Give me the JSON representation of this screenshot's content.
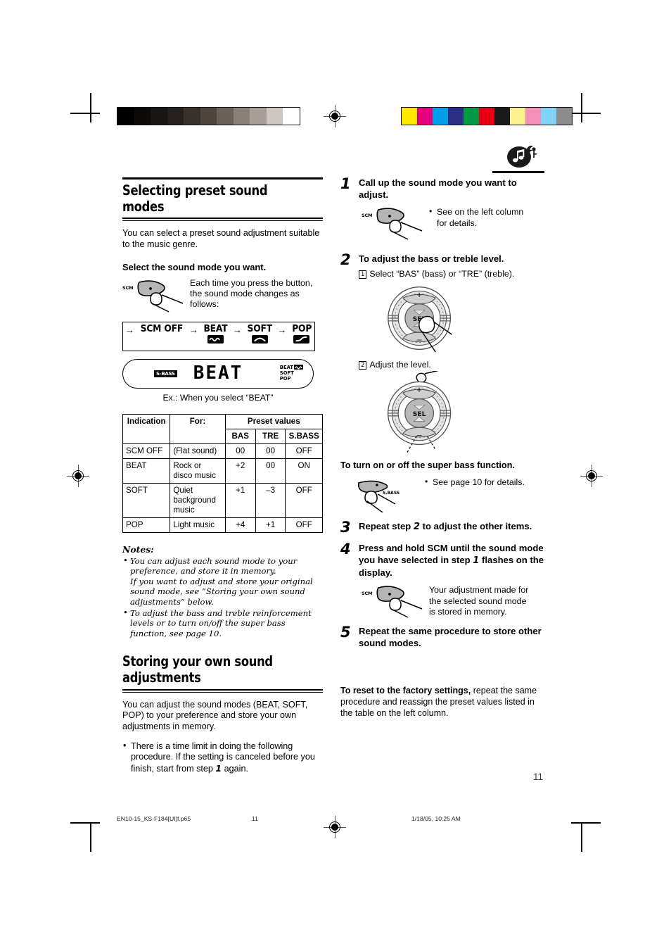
{
  "meta": {
    "page_number": "11"
  },
  "header_icon": "music-note-bag-icon",
  "left": {
    "section1": {
      "heading": "Selecting preset sound modes",
      "intro": "You can select a preset sound adjustment suitable to the music genre.",
      "subhead": "Select the sound mode you want.",
      "button_label": "SCM",
      "button_caption": "Each time you press the button, the sound mode changes as follows:",
      "flow": [
        {
          "name": "SCM OFF",
          "icon": ""
        },
        {
          "name": "BEAT",
          "icon": "wave-beat-icon"
        },
        {
          "name": "SOFT",
          "icon": "wave-soft-icon"
        },
        {
          "name": "POP",
          "icon": "wave-pop-icon"
        }
      ],
      "arrow": "→",
      "display": {
        "sbass_label": "S-BASS",
        "main_text": "BEAT",
        "indicators": [
          "BEAT",
          "SOFT",
          "POP"
        ],
        "beat_icon": "wave-beat-icon"
      },
      "example_caption": "Ex.: When you select “BEAT”"
    },
    "table": {
      "headers": {
        "indication": "Indication",
        "for": "For:",
        "preset_values": "Preset values",
        "bas": "BAS",
        "tre": "TRE",
        "sbass": "S.BASS"
      },
      "rows": [
        {
          "indication": "SCM OFF",
          "for": "(Flat sound)",
          "bas": "00",
          "tre": "00",
          "sbass": "OFF"
        },
        {
          "indication": "BEAT",
          "for": "Rock or disco music",
          "bas": "+2",
          "tre": "00",
          "sbass": "ON"
        },
        {
          "indication": "SOFT",
          "for": "Quiet background music",
          "bas": "+1",
          "tre": "–3",
          "sbass": "OFF"
        },
        {
          "indication": "POP",
          "for": "Light music",
          "bas": "+4",
          "tre": "+1",
          "sbass": "OFF"
        }
      ]
    },
    "notes": {
      "heading": "Notes:",
      "items": [
        {
          "line1": "You can adjust each sound mode to your preference, and store it in memory.",
          "line2": "If you want to adjust and store your original sound mode, see “Storing your own sound adjustments” below."
        },
        {
          "line1": "To adjust the bass and treble reinforcement levels or to turn on/off the super bass function, see page 10.",
          "line2": ""
        }
      ]
    },
    "section2": {
      "heading_line1": "Storing your own sound",
      "heading_line2": "adjustments",
      "intro": "You can adjust the sound modes (BEAT, SOFT, POP) to your preference and store your own adjustments in memory.",
      "bullet": "There is a time limit in doing the following procedure. If the setting is canceled before you finish, start from step 1 again.",
      "bullet_pre": "There is a time limit in doing the following procedure. If the setting is canceled before you finish, start from step ",
      "bullet_stepnum": "1",
      "bullet_post": " again."
    }
  },
  "right": {
    "steps": [
      {
        "num": "1",
        "title": "Call up the sound mode you want to adjust.",
        "button_label": "SCM",
        "note": "See on the left column for details."
      },
      {
        "num": "2",
        "title": "To adjust the bass or treble level.",
        "sub1_num": "1",
        "sub1_text": "Select “BAS” (bass) or “TRE” (treble).",
        "sub2_num": "2",
        "sub2_text": "Adjust the level.",
        "dial_center": "SEL",
        "dial_plus": "+",
        "dial_minus": "–"
      },
      {
        "num": "3",
        "title_pre": "Repeat step ",
        "title_num": "2",
        "title_post": " to adjust the other items."
      },
      {
        "num": "4",
        "title_pre": "Press and hold SCM until the sound mode you have selected in step ",
        "title_num": "1",
        "title_post": " flashes on the display.",
        "button_label": "SCM",
        "note": "Your adjustment made for the selected sound mode is stored in memory."
      },
      {
        "num": "5",
        "title": "Repeat the same procedure to store other sound modes."
      }
    ],
    "superbass": {
      "heading": "To turn on or off the super bass function.",
      "button_label": "S.BASS",
      "note": "See page 10 for details."
    },
    "reset": {
      "lead": "To reset to the factory settings,",
      "rest": " repeat the same procedure and reassign the preset values listed in the table on the left column."
    }
  },
  "footer": {
    "file": "EN10-15_KS-F184[UI]f.p65",
    "page": "11",
    "timestamp": "1/18/05, 10:25 AM"
  },
  "calibration": {
    "gray_ramp": [
      "#000000",
      "#0d0b0a",
      "#191614",
      "#26211e",
      "#38312c",
      "#4e453f",
      "#6b615a",
      "#8a807a",
      "#a79e98",
      "#cdc6c1",
      "#ffffff"
    ],
    "color_bars": [
      "#ffe800",
      "#e5007e",
      "#00a0e9",
      "#2b2f86",
      "#009944",
      "#e60012",
      "#1a1a1a",
      "#fbf08a",
      "#f48fb8",
      "#7fd4f5",
      "#8c8c8c"
    ]
  }
}
